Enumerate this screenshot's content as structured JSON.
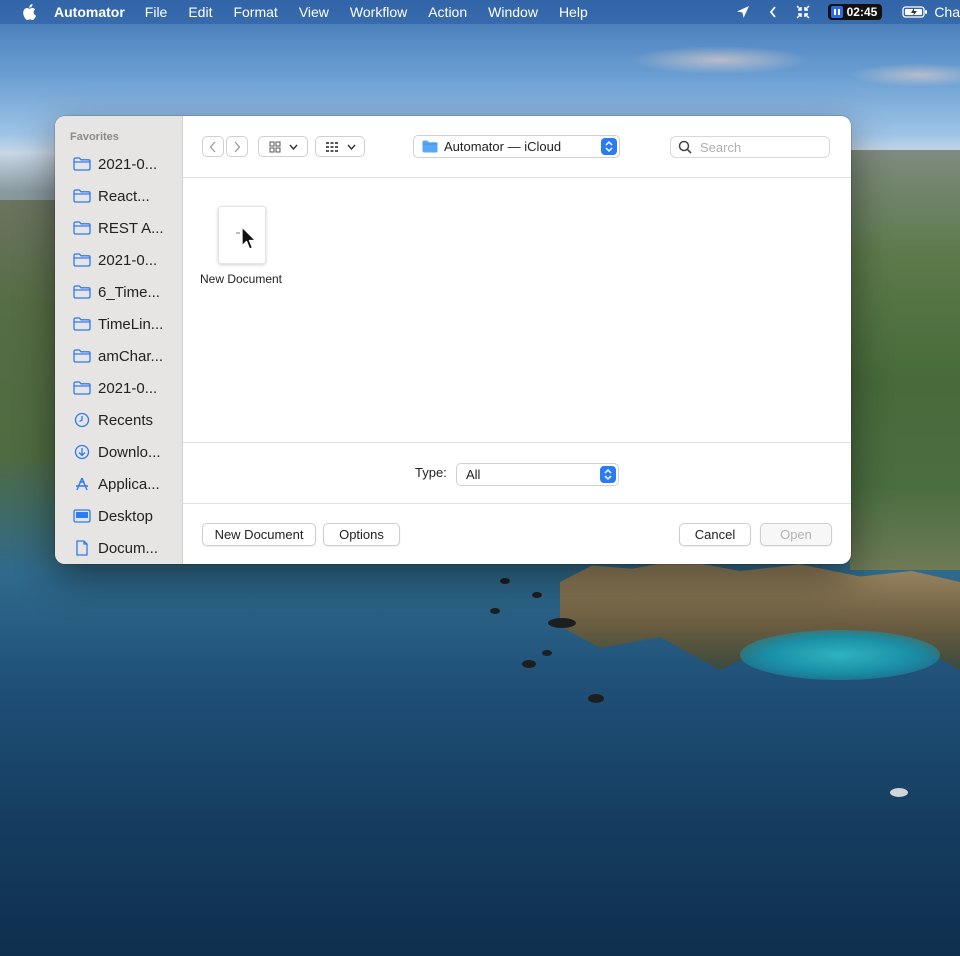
{
  "menubar": {
    "app_name": "Automator",
    "items": [
      "File",
      "Edit",
      "Format",
      "View",
      "Workflow",
      "Action",
      "Window",
      "Help"
    ],
    "clock": "02:45",
    "battery_label": "Cha"
  },
  "sidebar": {
    "section_title": "Favorites",
    "items": [
      {
        "label": "2021-0...",
        "icon": "folder-icon"
      },
      {
        "label": "React...",
        "icon": "folder-icon"
      },
      {
        "label": "REST A...",
        "icon": "folder-icon"
      },
      {
        "label": "2021-0...",
        "icon": "folder-icon"
      },
      {
        "label": "6_Time...",
        "icon": "folder-icon"
      },
      {
        "label": "TimeLin...",
        "icon": "folder-icon"
      },
      {
        "label": "amChar...",
        "icon": "folder-icon"
      },
      {
        "label": "2021-0...",
        "icon": "folder-icon"
      },
      {
        "label": "Recents",
        "icon": "clock-icon"
      },
      {
        "label": "Downlo...",
        "icon": "download-icon"
      },
      {
        "label": "Applica...",
        "icon": "applications-icon"
      },
      {
        "label": "Desktop",
        "icon": "desktop-icon"
      },
      {
        "label": "Docum...",
        "icon": "document-icon"
      }
    ]
  },
  "toolbar": {
    "location": "Automator — iCloud",
    "search_placeholder": "Search"
  },
  "browser": {
    "items": [
      {
        "label": "New Document"
      }
    ]
  },
  "type_row": {
    "label": "Type:",
    "selected": "All"
  },
  "buttons": {
    "new_document": "New Document",
    "options": "Options",
    "cancel": "Cancel",
    "open": "Open"
  },
  "colors": {
    "accent": "#2b7bf3",
    "sidebar_icon": "#2b7bf3"
  }
}
